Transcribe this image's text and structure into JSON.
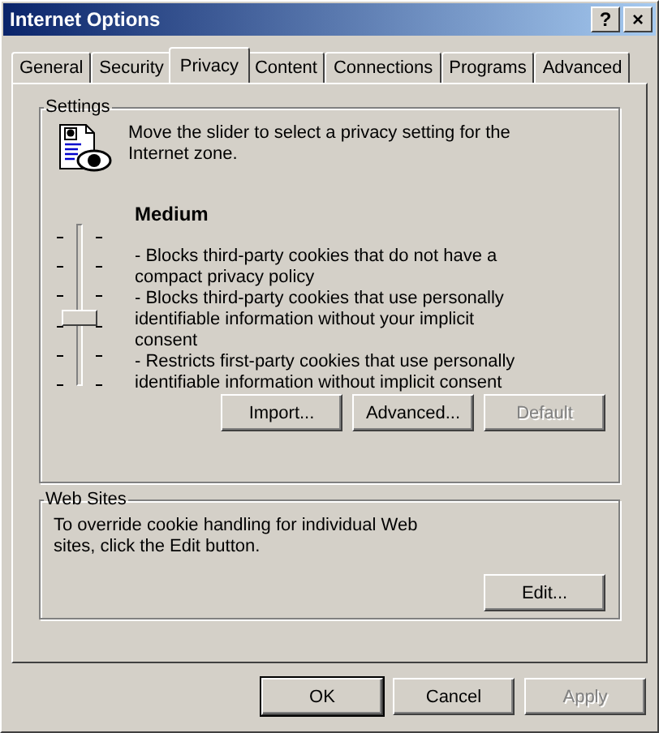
{
  "window": {
    "title": "Internet Options",
    "title_buttons": [
      "?",
      "×"
    ]
  },
  "tabs": [
    {
      "label": "General",
      "selected": false
    },
    {
      "label": "Security",
      "selected": false
    },
    {
      "label": "Privacy",
      "selected": true
    },
    {
      "label": "Content",
      "selected": false
    },
    {
      "label": "Connections",
      "selected": false
    },
    {
      "label": "Programs",
      "selected": false
    },
    {
      "label": "Advanced",
      "selected": false
    }
  ],
  "settings": {
    "title": "Settings",
    "instruction": "Move the slider to select a privacy setting for the Internet zone.",
    "slider": {
      "level": 0.4
    },
    "level_name": "Medium",
    "description": [
      "- Blocks third-party cookies that do not have a compact privacy policy",
      "- Blocks third-party cookies that use personally identifiable information without your implicit consent",
      "- Restricts first-party cookies that use personally identifiable information without implicit consent"
    ],
    "buttons": [
      {
        "label": "Import...",
        "disabled": false
      },
      {
        "label": "Advanced...",
        "disabled": false
      },
      {
        "label": "Default",
        "disabled": true
      }
    ]
  },
  "web_sites": {
    "title": "Web Sites",
    "text": "To override cookie handling for individual Web sites, click the Edit button.",
    "button": {
      "label": "Edit...",
      "disabled": false
    }
  },
  "buttons": [
    {
      "label": "OK",
      "disabled": false,
      "default": true
    },
    {
      "label": "Cancel",
      "disabled": false,
      "default": false
    },
    {
      "label": "Apply",
      "disabled": true,
      "default": false
    }
  ]
}
